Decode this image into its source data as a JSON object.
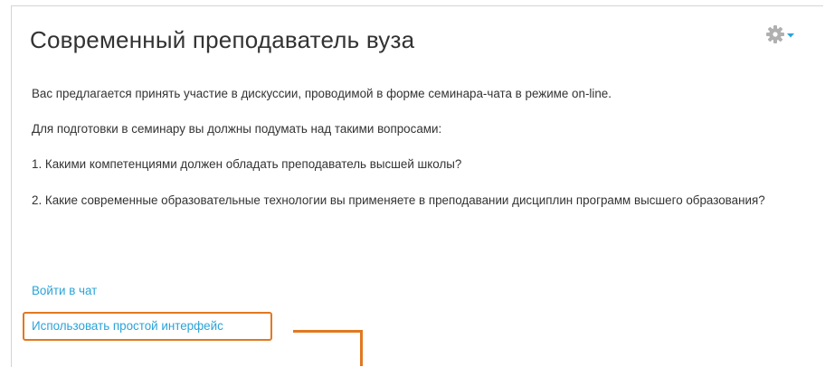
{
  "page": {
    "title": "Современный преподаватель вуза",
    "gear_icon": "gear-icon",
    "dropdown_icon": "caret-down-icon"
  },
  "content": {
    "intro": "Вас предлагается принять участие в дискуссии, проводимой в форме семинара-чата в режиме on-line.",
    "prep": "Для подготовки  в семинару вы должны подумать над такими вопросами:",
    "question_1": "1. Какими компетенциями должен обладать преподаватель высшей школы?",
    "question_2": "2. Какие современные образовательные технологии вы применяете в преподавании дисциплин программ высшего образования?"
  },
  "links": {
    "enter_chat": "Войти в чат",
    "simple_interface": "Использовать простой интерфейс"
  },
  "colors": {
    "link": "#2aa3d8",
    "highlight": "#e2781f",
    "text": "#333333",
    "icon": "#b0b0b0"
  }
}
